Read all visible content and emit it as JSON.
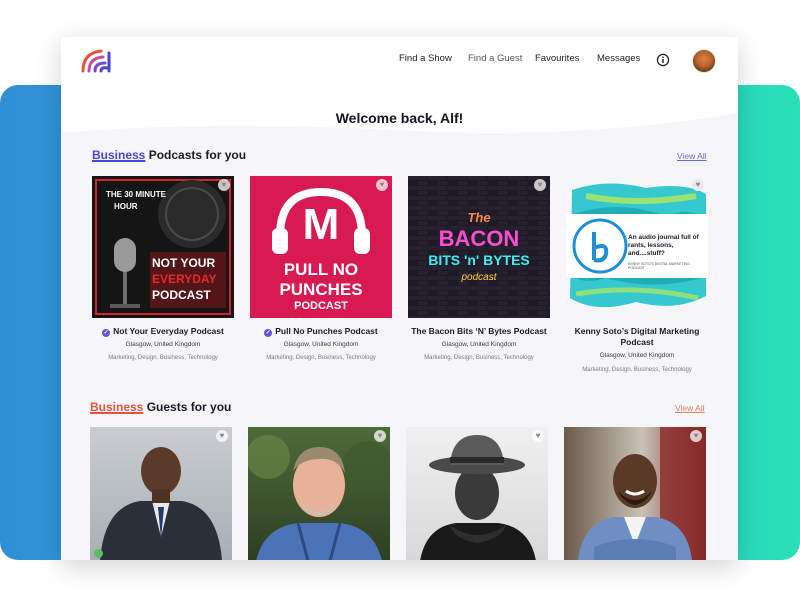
{
  "nav": {
    "links": [
      "Find a Show",
      "Find a Guest",
      "Favourites",
      "Messages"
    ]
  },
  "welcome": "Welcome back, Alf!",
  "podcasts_section": {
    "keyword": "Business",
    "rest": " Podcasts for you",
    "view_all": "View All",
    "cards": [
      {
        "title": "Not Your Everyday Podcast",
        "verified": true,
        "location": "Glasgow, United Kingdom",
        "tags": "Marketing, Design, Business, Technology",
        "art_top": "THE 30 MINUTE",
        "art_top2": "HOUR",
        "art_l1": "NOT YOUR",
        "art_l2": "EVERYDAY",
        "art_l3": "PODCAST"
      },
      {
        "title": "Pull No Punches Podcast",
        "verified": true,
        "location": "Glasgow, United Kingdom",
        "tags": "Marketing, Design, Business, Technology",
        "art_m": "M",
        "art_l1": "PULL NO",
        "art_l2": "PUNCHES",
        "art_l3": "PODCAST"
      },
      {
        "title": "The Bacon Bits ‘N’ Bytes Podcast",
        "verified": false,
        "location": "Glasgow, United Kingdom",
        "tags": "Marketing, Design, Business, Technology",
        "art_l1": "The",
        "art_l2": "BACON",
        "art_l3": "BITS 'n' BYTES",
        "art_l4": "podcast"
      },
      {
        "title": "Kenny Soto’s Digital Marketing Podcast",
        "verified": false,
        "location": "Glasgow, United Kingdom",
        "tags": "Marketing, Design, Business, Technology",
        "art_text": "An audio journal full of rants, lessons, and....stuff?",
        "art_sub": "KENNY SOTO'S DIGITAL MARKETING PODCAST"
      }
    ]
  },
  "guests_section": {
    "keyword": "Business",
    "rest": " Guests for you",
    "view_all": "View All"
  },
  "colors": {
    "accent_blue": "#4b45d6",
    "accent_red": "#e2543e",
    "verified": "#6a4fd8",
    "band_left": "#2f8fd6",
    "band_right": "#29e0b8"
  }
}
